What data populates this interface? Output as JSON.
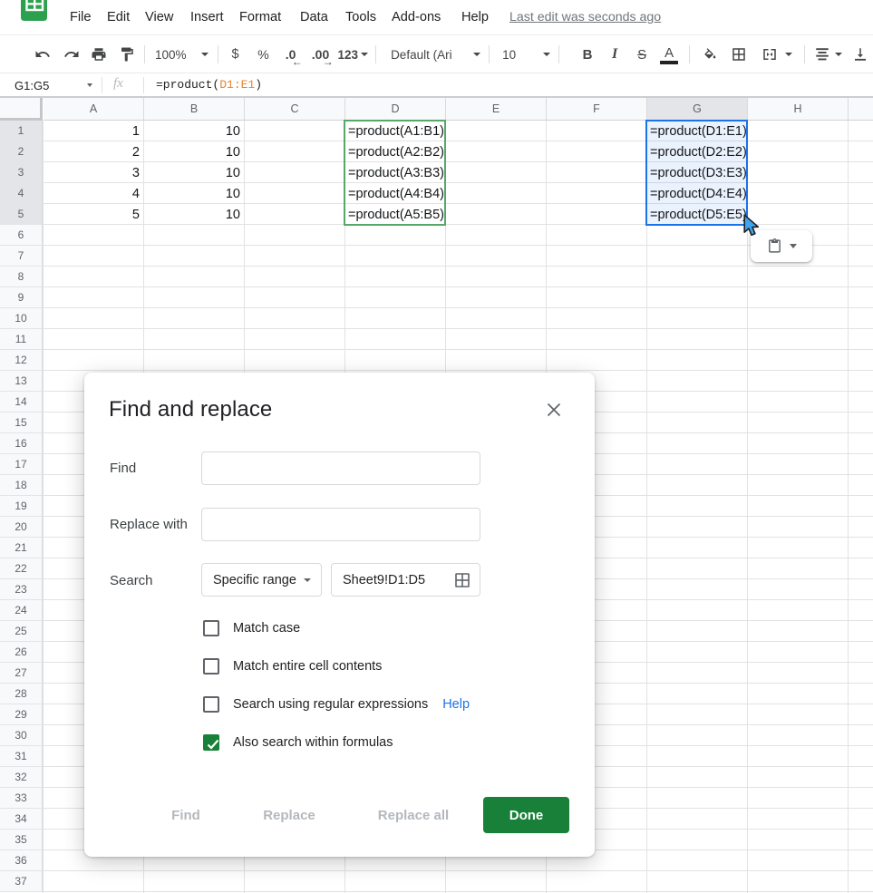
{
  "menubar": {
    "items": [
      "File",
      "Edit",
      "View",
      "Insert",
      "Format",
      "Data",
      "Tools",
      "Add-ons",
      "Help"
    ],
    "last_edit": "Last edit was seconds ago"
  },
  "toolbar": {
    "zoom": "100%",
    "currency": "$",
    "percent": "%",
    "decrease_decimal": ".0",
    "increase_decimal": ".00",
    "more_formats": "123",
    "font": "Default (Ari",
    "font_size": "10",
    "bold": "B",
    "italic": "I",
    "strikethrough": "S",
    "text_color": "A",
    "icons": [
      "undo-icon",
      "redo-icon",
      "print-icon",
      "paint-format-icon",
      "fill-color-icon",
      "borders-icon",
      "merge-cells-icon",
      "horizontal-align-icon",
      "vertical-align-icon"
    ]
  },
  "formula_bar": {
    "name_box": "G1:G5",
    "fx": "fx",
    "formula_prefix": "=product(",
    "formula_range": "D1:E1",
    "formula_suffix": ")"
  },
  "grid": {
    "columns": [
      "A",
      "B",
      "C",
      "D",
      "E",
      "F",
      "G",
      "H"
    ],
    "visible_rows": 37,
    "selected_column": "G",
    "selected_rows": [
      1,
      2,
      3,
      4,
      5
    ],
    "selection_range": "G1:G5",
    "search_highlight_range": "D1:D5",
    "cells": [
      {
        "ref": "A1",
        "col": "A",
        "row": 1,
        "value": "1",
        "align": "right"
      },
      {
        "ref": "A2",
        "col": "A",
        "row": 2,
        "value": "2",
        "align": "right"
      },
      {
        "ref": "A3",
        "col": "A",
        "row": 3,
        "value": "3",
        "align": "right"
      },
      {
        "ref": "A4",
        "col": "A",
        "row": 4,
        "value": "4",
        "align": "right"
      },
      {
        "ref": "A5",
        "col": "A",
        "row": 5,
        "value": "5",
        "align": "right"
      },
      {
        "ref": "B1",
        "col": "B",
        "row": 1,
        "value": "10",
        "align": "right"
      },
      {
        "ref": "B2",
        "col": "B",
        "row": 2,
        "value": "10",
        "align": "right"
      },
      {
        "ref": "B3",
        "col": "B",
        "row": 3,
        "value": "10",
        "align": "right"
      },
      {
        "ref": "B4",
        "col": "B",
        "row": 4,
        "value": "10",
        "align": "right"
      },
      {
        "ref": "B5",
        "col": "B",
        "row": 5,
        "value": "10",
        "align": "right"
      },
      {
        "ref": "D1",
        "col": "D",
        "row": 1,
        "value": "=product(A1:B1)",
        "align": "left"
      },
      {
        "ref": "D2",
        "col": "D",
        "row": 2,
        "value": "=product(A2:B2)",
        "align": "left"
      },
      {
        "ref": "D3",
        "col": "D",
        "row": 3,
        "value": "=product(A3:B3)",
        "align": "left"
      },
      {
        "ref": "D4",
        "col": "D",
        "row": 4,
        "value": "=product(A4:B4)",
        "align": "left"
      },
      {
        "ref": "D5",
        "col": "D",
        "row": 5,
        "value": "=product(A5:B5)",
        "align": "left"
      },
      {
        "ref": "G1",
        "col": "G",
        "row": 1,
        "value": "=product(D1:E1)",
        "align": "left"
      },
      {
        "ref": "G2",
        "col": "G",
        "row": 2,
        "value": "=product(D2:E2)",
        "align": "left"
      },
      {
        "ref": "G3",
        "col": "G",
        "row": 3,
        "value": "=product(D3:E3)",
        "align": "left"
      },
      {
        "ref": "G4",
        "col": "G",
        "row": 4,
        "value": "=product(D4:E4)",
        "align": "left"
      },
      {
        "ref": "G5",
        "col": "G",
        "row": 5,
        "value": "=product(D5:E5)",
        "align": "left"
      }
    ]
  },
  "paste_widget": {
    "icon": "clipboard-icon"
  },
  "dialog": {
    "title": "Find and replace",
    "find_label": "Find",
    "find_value": "",
    "replace_label": "Replace with",
    "replace_value": "",
    "search_label": "Search",
    "search_value": "Specific range",
    "range_value": "Sheet9!D1:D5",
    "checkboxes": [
      {
        "label": "Match case",
        "checked": false
      },
      {
        "label": "Match entire cell contents",
        "checked": false
      },
      {
        "label": "Search using regular expressions",
        "checked": false,
        "help": "Help"
      },
      {
        "label": "Also search within formulas",
        "checked": true
      }
    ],
    "buttons": {
      "find": "Find",
      "replace": "Replace",
      "replace_all": "Replace all",
      "done": "Done"
    }
  },
  "colors": {
    "selection_blue": "#1a73e8",
    "search_range_green": "#56a868",
    "formula_range_orange": "#e8862e",
    "done_button_green": "#188038",
    "checkbox_checked_green": "#188038",
    "logo_green": "#28a748",
    "link_blue": "#1a73e8"
  }
}
